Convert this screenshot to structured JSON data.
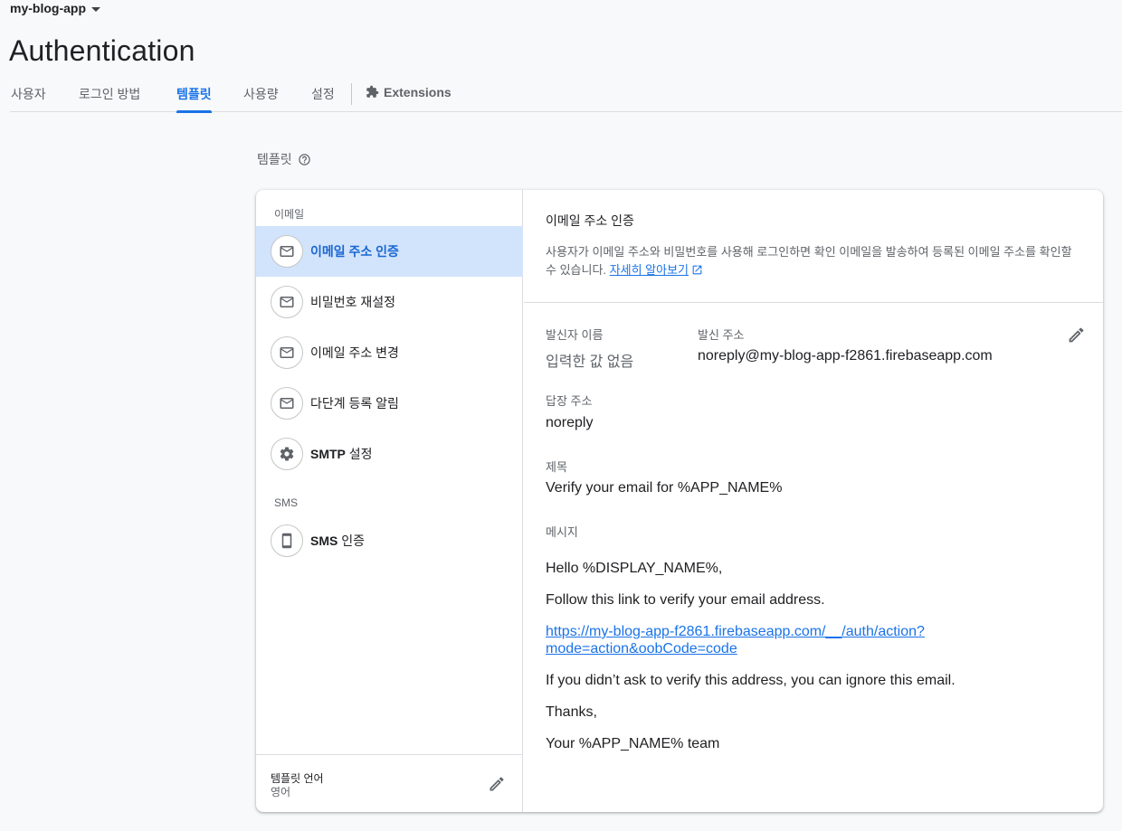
{
  "project": {
    "name": "my-blog-app"
  },
  "page": {
    "title": "Authentication"
  },
  "tabs": [
    {
      "label": "사용자"
    },
    {
      "label": "로그인 방법"
    },
    {
      "label": "템플릿",
      "active": true
    },
    {
      "label": "사용량"
    },
    {
      "label": "설정"
    },
    {
      "label": "Extensions"
    }
  ],
  "section": {
    "label": "템플릿",
    "help_icon": "help-circle-icon"
  },
  "sidebar": {
    "email_group_label": "이메일",
    "sms_group_label": "SMS",
    "items": [
      {
        "label": "이메일 주소 인증",
        "icon": "mail-icon",
        "selected": true
      },
      {
        "label": "비밀번호 재설정",
        "icon": "mail-icon"
      },
      {
        "label": "이메일 주소 변경",
        "icon": "mail-icon"
      },
      {
        "label": "다단계 등록 알림",
        "icon": "mail-icon"
      },
      {
        "label_bold": "SMTP",
        "label_rest": " 설정",
        "icon": "gear-icon"
      },
      {
        "label_bold": "SMS",
        "label_rest": " 인증",
        "icon": "phone-icon"
      }
    ],
    "language": {
      "title": "템플릿 언어",
      "value": "영어",
      "edit_icon": "pencil-icon"
    }
  },
  "detail": {
    "title": "이메일 주소 인증",
    "description": "사용자가 이메일 주소와 비밀번호를 사용해 로그인하면 확인 이메일을 발송하여 등록된 이메일 주소를 확인할 수 있습니다.",
    "learn_more": "자세히 알아보기",
    "sender_name_label": "발신자 이름",
    "sender_name_value": "입력한 값 없음",
    "sender_address_label": "발신 주소",
    "sender_address_value": "noreply@my-blog-app-f2861.firebaseapp.com",
    "reply_to_label": "답장 주소",
    "reply_to_value": "noreply",
    "subject_label": "제목",
    "subject_value": "Verify your email for %APP_NAME%",
    "message_label": "메시지",
    "message": {
      "greeting": "Hello %DISPLAY_NAME%,",
      "line1": "Follow this link to verify your email address.",
      "link_part1": "https://my-blog-app-f2861.firebaseapp.com/__/auth/action?",
      "link_part2": "mode=action&oobCode=code",
      "line2": "If you didn’t ask to verify this address, you can ignore this email.",
      "thanks": "Thanks,",
      "signature": "Your %APP_NAME% team"
    }
  },
  "colors": {
    "accent": "#1a73e8",
    "selected_bg": "#d2e3fc",
    "page_bg": "#f8f9fa"
  }
}
